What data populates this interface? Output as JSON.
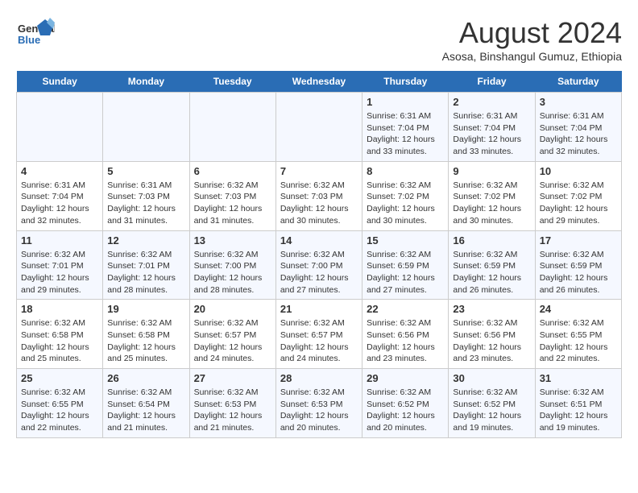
{
  "logo": {
    "line1": "General",
    "line2": "Blue"
  },
  "title": "August 2024",
  "subtitle": "Asosa, Binshangul Gumuz, Ethiopia",
  "days": [
    "Sunday",
    "Monday",
    "Tuesday",
    "Wednesday",
    "Thursday",
    "Friday",
    "Saturday"
  ],
  "weeks": [
    [
      {
        "day": "",
        "info": ""
      },
      {
        "day": "",
        "info": ""
      },
      {
        "day": "",
        "info": ""
      },
      {
        "day": "",
        "info": ""
      },
      {
        "day": "1",
        "info": "Sunrise: 6:31 AM\nSunset: 7:04 PM\nDaylight: 12 hours\nand 33 minutes."
      },
      {
        "day": "2",
        "info": "Sunrise: 6:31 AM\nSunset: 7:04 PM\nDaylight: 12 hours\nand 33 minutes."
      },
      {
        "day": "3",
        "info": "Sunrise: 6:31 AM\nSunset: 7:04 PM\nDaylight: 12 hours\nand 32 minutes."
      }
    ],
    [
      {
        "day": "4",
        "info": "Sunrise: 6:31 AM\nSunset: 7:04 PM\nDaylight: 12 hours\nand 32 minutes."
      },
      {
        "day": "5",
        "info": "Sunrise: 6:31 AM\nSunset: 7:03 PM\nDaylight: 12 hours\nand 31 minutes."
      },
      {
        "day": "6",
        "info": "Sunrise: 6:32 AM\nSunset: 7:03 PM\nDaylight: 12 hours\nand 31 minutes."
      },
      {
        "day": "7",
        "info": "Sunrise: 6:32 AM\nSunset: 7:03 PM\nDaylight: 12 hours\nand 30 minutes."
      },
      {
        "day": "8",
        "info": "Sunrise: 6:32 AM\nSunset: 7:02 PM\nDaylight: 12 hours\nand 30 minutes."
      },
      {
        "day": "9",
        "info": "Sunrise: 6:32 AM\nSunset: 7:02 PM\nDaylight: 12 hours\nand 30 minutes."
      },
      {
        "day": "10",
        "info": "Sunrise: 6:32 AM\nSunset: 7:02 PM\nDaylight: 12 hours\nand 29 minutes."
      }
    ],
    [
      {
        "day": "11",
        "info": "Sunrise: 6:32 AM\nSunset: 7:01 PM\nDaylight: 12 hours\nand 29 minutes."
      },
      {
        "day": "12",
        "info": "Sunrise: 6:32 AM\nSunset: 7:01 PM\nDaylight: 12 hours\nand 28 minutes."
      },
      {
        "day": "13",
        "info": "Sunrise: 6:32 AM\nSunset: 7:00 PM\nDaylight: 12 hours\nand 28 minutes."
      },
      {
        "day": "14",
        "info": "Sunrise: 6:32 AM\nSunset: 7:00 PM\nDaylight: 12 hours\nand 27 minutes."
      },
      {
        "day": "15",
        "info": "Sunrise: 6:32 AM\nSunset: 6:59 PM\nDaylight: 12 hours\nand 27 minutes."
      },
      {
        "day": "16",
        "info": "Sunrise: 6:32 AM\nSunset: 6:59 PM\nDaylight: 12 hours\nand 26 minutes."
      },
      {
        "day": "17",
        "info": "Sunrise: 6:32 AM\nSunset: 6:59 PM\nDaylight: 12 hours\nand 26 minutes."
      }
    ],
    [
      {
        "day": "18",
        "info": "Sunrise: 6:32 AM\nSunset: 6:58 PM\nDaylight: 12 hours\nand 25 minutes."
      },
      {
        "day": "19",
        "info": "Sunrise: 6:32 AM\nSunset: 6:58 PM\nDaylight: 12 hours\nand 25 minutes."
      },
      {
        "day": "20",
        "info": "Sunrise: 6:32 AM\nSunset: 6:57 PM\nDaylight: 12 hours\nand 24 minutes."
      },
      {
        "day": "21",
        "info": "Sunrise: 6:32 AM\nSunset: 6:57 PM\nDaylight: 12 hours\nand 24 minutes."
      },
      {
        "day": "22",
        "info": "Sunrise: 6:32 AM\nSunset: 6:56 PM\nDaylight: 12 hours\nand 23 minutes."
      },
      {
        "day": "23",
        "info": "Sunrise: 6:32 AM\nSunset: 6:56 PM\nDaylight: 12 hours\nand 23 minutes."
      },
      {
        "day": "24",
        "info": "Sunrise: 6:32 AM\nSunset: 6:55 PM\nDaylight: 12 hours\nand 22 minutes."
      }
    ],
    [
      {
        "day": "25",
        "info": "Sunrise: 6:32 AM\nSunset: 6:55 PM\nDaylight: 12 hours\nand 22 minutes."
      },
      {
        "day": "26",
        "info": "Sunrise: 6:32 AM\nSunset: 6:54 PM\nDaylight: 12 hours\nand 21 minutes."
      },
      {
        "day": "27",
        "info": "Sunrise: 6:32 AM\nSunset: 6:53 PM\nDaylight: 12 hours\nand 21 minutes."
      },
      {
        "day": "28",
        "info": "Sunrise: 6:32 AM\nSunset: 6:53 PM\nDaylight: 12 hours\nand 20 minutes."
      },
      {
        "day": "29",
        "info": "Sunrise: 6:32 AM\nSunset: 6:52 PM\nDaylight: 12 hours\nand 20 minutes."
      },
      {
        "day": "30",
        "info": "Sunrise: 6:32 AM\nSunset: 6:52 PM\nDaylight: 12 hours\nand 19 minutes."
      },
      {
        "day": "31",
        "info": "Sunrise: 6:32 AM\nSunset: 6:51 PM\nDaylight: 12 hours\nand 19 minutes."
      }
    ]
  ]
}
